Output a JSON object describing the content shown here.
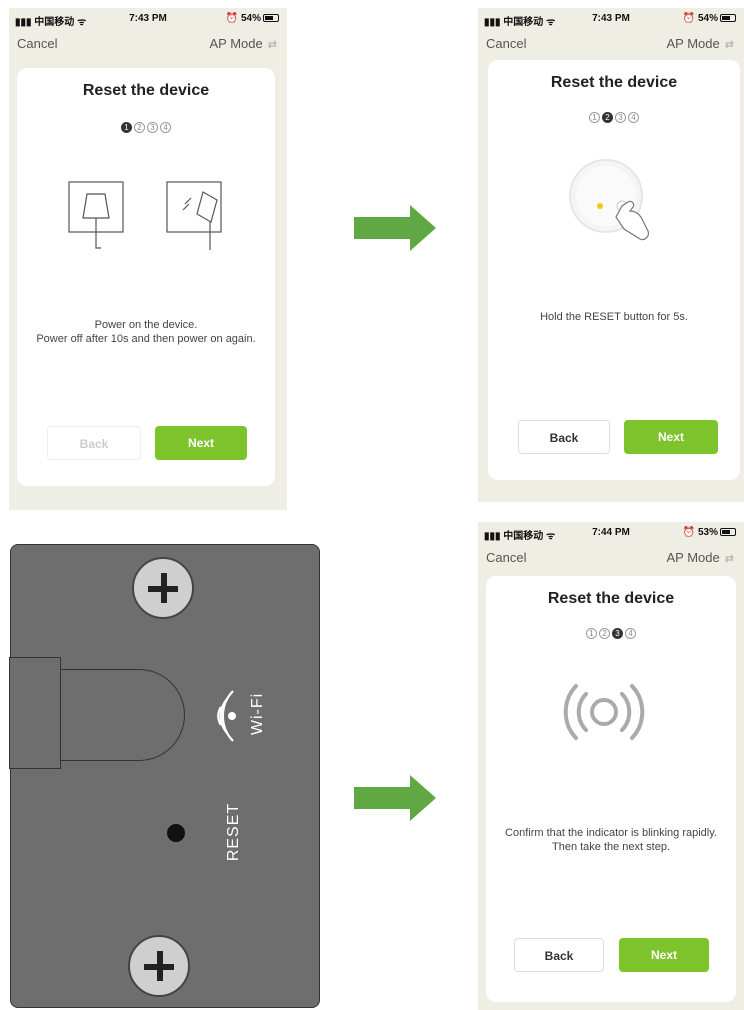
{
  "status": {
    "carrier": "中国移动",
    "screens": [
      {
        "time": "7:43 PM",
        "battery": "54%"
      },
      {
        "time": "7:43 PM",
        "battery": "54%"
      },
      {
        "time": "7:44 PM",
        "battery": "53%"
      }
    ]
  },
  "nav": {
    "cancel": "Cancel",
    "ap_mode": "AP Mode"
  },
  "card_title": "Reset the device",
  "steps": [
    "1",
    "2",
    "3",
    "4"
  ],
  "screen1": {
    "active_step": 1,
    "instruction": "Power on the device.\nPower off after 10s and then power on again.",
    "back": "Back",
    "next": "Next"
  },
  "screen2": {
    "active_step": 2,
    "instruction": "Hold the RESET button for 5s.",
    "back": "Back",
    "next": "Next"
  },
  "screen3": {
    "active_step": 3,
    "instruction": "Confirm that the indicator is blinking rapidly.\nThen take the next step.",
    "back": "Back",
    "next": "Next"
  },
  "device": {
    "wifi_label": "Wi-Fi",
    "reset_label": "RESET"
  },
  "colors": {
    "accent": "#7dc32c",
    "arrow": "#5fa843",
    "screen_bg": "#efeee4",
    "device": "#6e6e6e"
  }
}
